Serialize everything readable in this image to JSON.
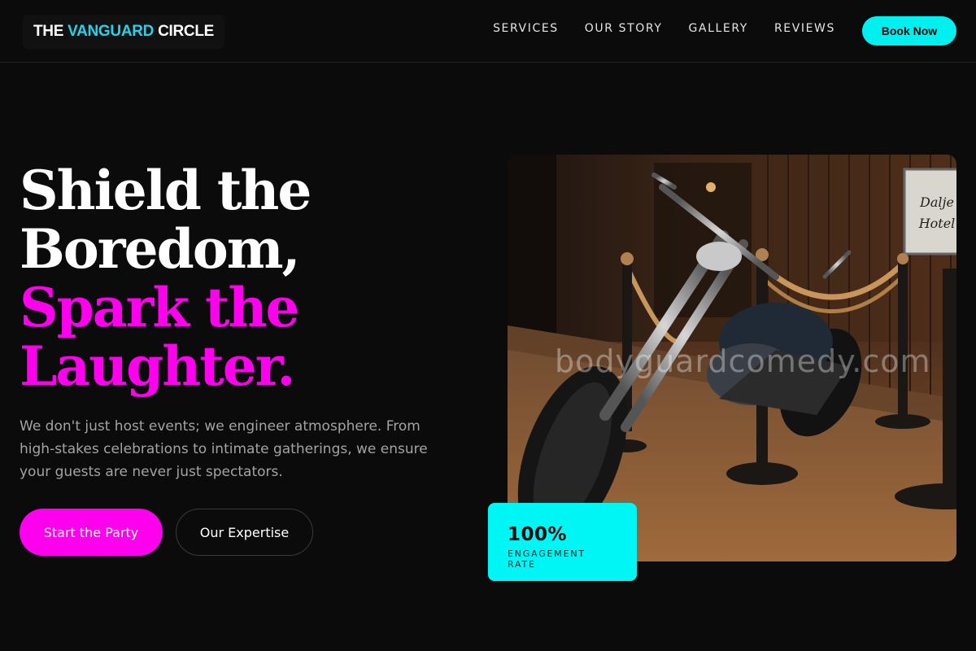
{
  "brand": {
    "name_part1": "THE",
    "name_part2": "VANGUARD",
    "name_part3": "CIRCLE",
    "accent_color": "#22d3ee"
  },
  "nav": {
    "items": [
      {
        "label": "SERVICES"
      },
      {
        "label": "OUR STORY"
      },
      {
        "label": "GALLERY"
      },
      {
        "label": "REVIEWS"
      }
    ],
    "cta_label": "Book Now"
  },
  "hero": {
    "title_lines": [
      "Shield the",
      "Boredom,",
      "Spark the",
      "Laughter."
    ],
    "highlight_color": "#ff00ee",
    "description": "We don't just host events; we engineer atmosphere. From high-stakes celebrations to intimate gatherings, we ensure your guests are never just spectators.",
    "primary_button": "Start the Party",
    "secondary_button": "Our Expertise"
  },
  "image": {
    "watermark": "bodyguardcomedy.com",
    "sign_line1": "Dalje",
    "sign_line2": "Hotel"
  },
  "stat": {
    "value": "100%",
    "label": "ENGAGEMENT RATE",
    "color": "#00f5f5"
  }
}
